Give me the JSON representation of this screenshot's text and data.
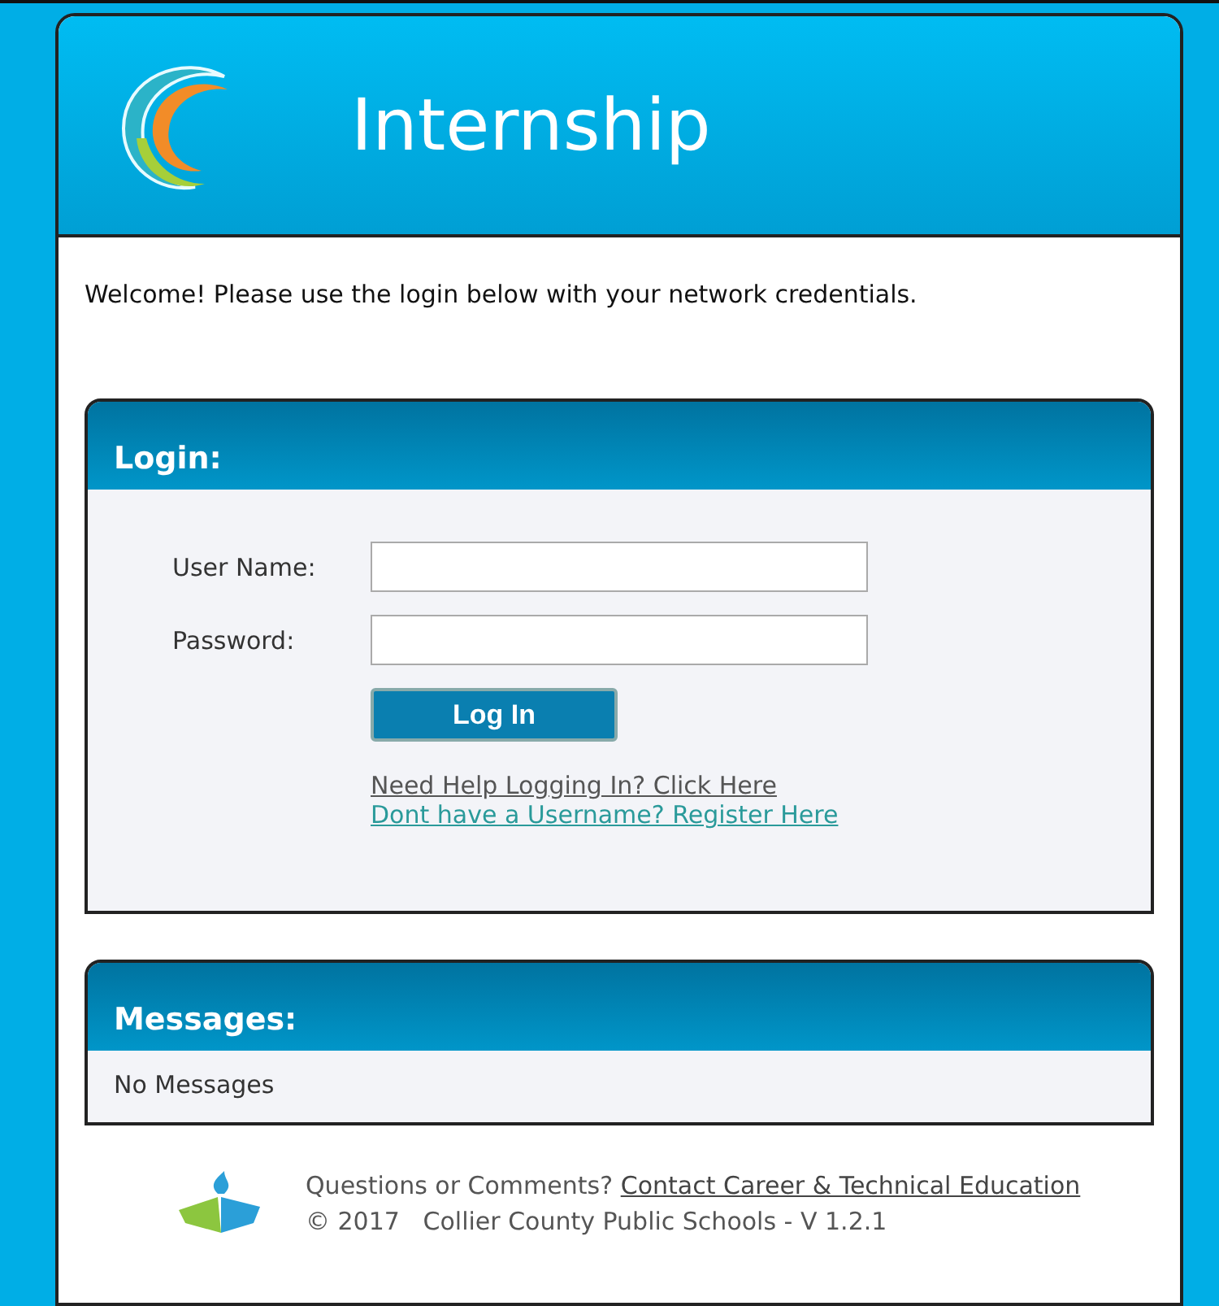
{
  "header": {
    "title": "Internship"
  },
  "welcome": "Welcome! Please use the login below with your network credentials.",
  "login": {
    "title": "Login:",
    "fields": [
      {
        "label": "User Name:"
      },
      {
        "label": "Password:"
      }
    ],
    "button": "Log In",
    "links": [
      {
        "text": "Need Help Logging In? Click Here",
        "kind": "help"
      },
      {
        "text": "Dont have a Username? Register Here",
        "kind": "register"
      }
    ]
  },
  "messages": {
    "title": "Messages:",
    "body": "No Messages"
  },
  "footer": {
    "question": "Questions or Comments?",
    "link": "Contact Career & Technical Education",
    "copyright": "© 2017   Collier County Public Schools - V 1.2.1"
  }
}
